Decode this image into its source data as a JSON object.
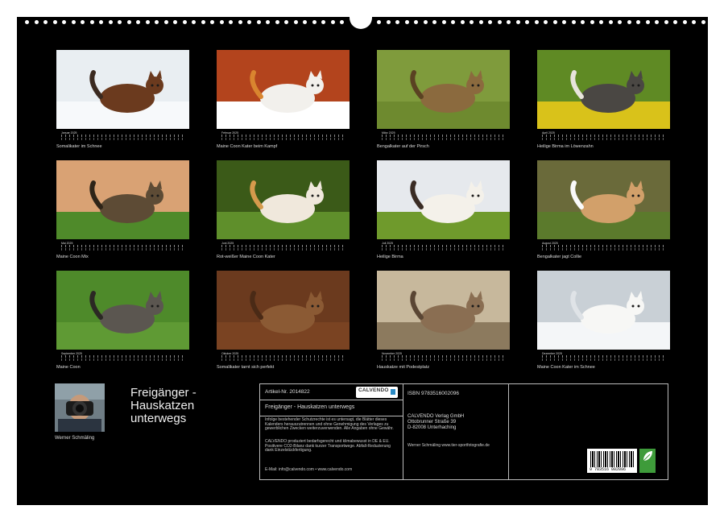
{
  "months": [
    {
      "month": "Januar 2025",
      "caption": "Somalikater im Schnee"
    },
    {
      "month": "Februar 2025",
      "caption": "Maine Coon Kater beim Kampf"
    },
    {
      "month": "März 2025",
      "caption": "Bengalkater auf der Pirsch"
    },
    {
      "month": "April 2025",
      "caption": "Heilige Birma im Löwenzahn"
    },
    {
      "month": "Mai 2025",
      "caption": "Maine Coon Mix"
    },
    {
      "month": "Juni 2025",
      "caption": "Rot-weißer Maine Coon Kater"
    },
    {
      "month": "Juli 2025",
      "caption": "Heilige Birma"
    },
    {
      "month": "August 2025",
      "caption": "Bengalkater jagt Collie"
    },
    {
      "month": "September 2025",
      "caption": "Maine Coon"
    },
    {
      "month": "Oktober 2025",
      "caption": "Somalikater tarnt sich perfekt"
    },
    {
      "month": "November 2025",
      "caption": "Hauskatze mit Podestplatz"
    },
    {
      "month": "Dezember 2025",
      "caption": "Maine Coon Kater im Schnee"
    }
  ],
  "author": "Werner Schmäling",
  "calendar_title": "Freigänger -\nHauskatzen\nunterwegs",
  "info": {
    "article_no": "Artikel-Nr. 2014822",
    "brand": "CALVENDO",
    "title": "Freigänger - Hauskatzen unterwegs",
    "legal1": "Infolge bestehender Schutzrechte ist es untersagt, die Blätter dieses Kalenders herauszutrennen und ohne Genehmigung des Verlages zu gewerblichen Zwecken weiterzuverwenden. Alle Angaben ohne Gewähr.",
    "legal2": "CALVENDO produziert bedarfsgerecht und klimabewusst in DE & EU. Positivere CO2-Bilanz dank kurzer Transportwege. Abfall-Reduzierung dank Einzelstückfertigung.",
    "contact": "E-Mail: info@calvendo.com • www.calvendo.com",
    "isbn": "ISBN 9783516002096",
    "publisher_name": "CALVENDO Verlag GmbH",
    "publisher_street": "Ottobrunner Straße 39",
    "publisher_city": "D-82008 Unterhaching",
    "photographer": "Werner Schmäling www.tier-sportfotografie.de",
    "barcode_number": "9 783516 002096"
  }
}
